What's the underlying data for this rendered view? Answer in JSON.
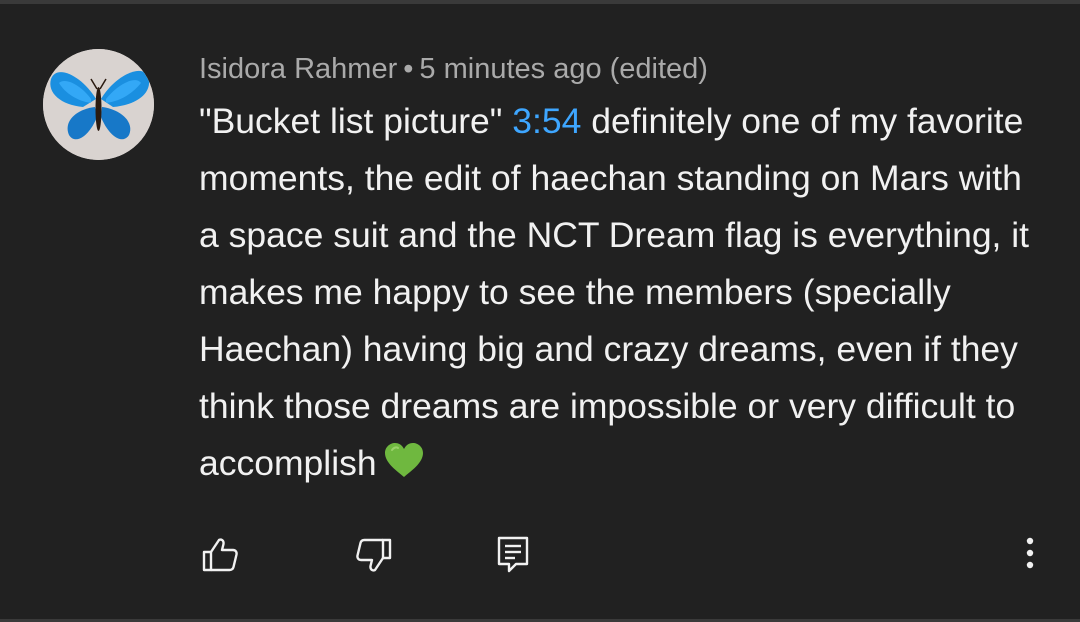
{
  "comment": {
    "author": "Isidora Rahmer",
    "separator": "•",
    "time_ago": "5 minutes ago",
    "edited": "(edited)",
    "text_before_link": "\"Bucket list picture\" ",
    "timestamp_link": "3:54",
    "text_after_link": " definitely one of my favorite moments, the edit of haechan standing on Mars with a space suit and the NCT Dream flag is everything, it makes me happy to see the members (specially Haechan) having big and crazy dreams, even if they think those dreams are impossible or very difficult to accomplish",
    "emoji": "green-heart",
    "avatar": "blue-butterfly"
  },
  "actions": {
    "like_icon": "thumbs-up-icon",
    "dislike_icon": "thumbs-down-icon",
    "reply_icon": "reply-comment-icon",
    "more_icon": "more-vertical-icon"
  },
  "colors": {
    "background": "#212121",
    "text": "#f1f1f1",
    "meta": "#aaaaaa",
    "link": "#3ea6ff",
    "heart": "#6fb83f"
  }
}
